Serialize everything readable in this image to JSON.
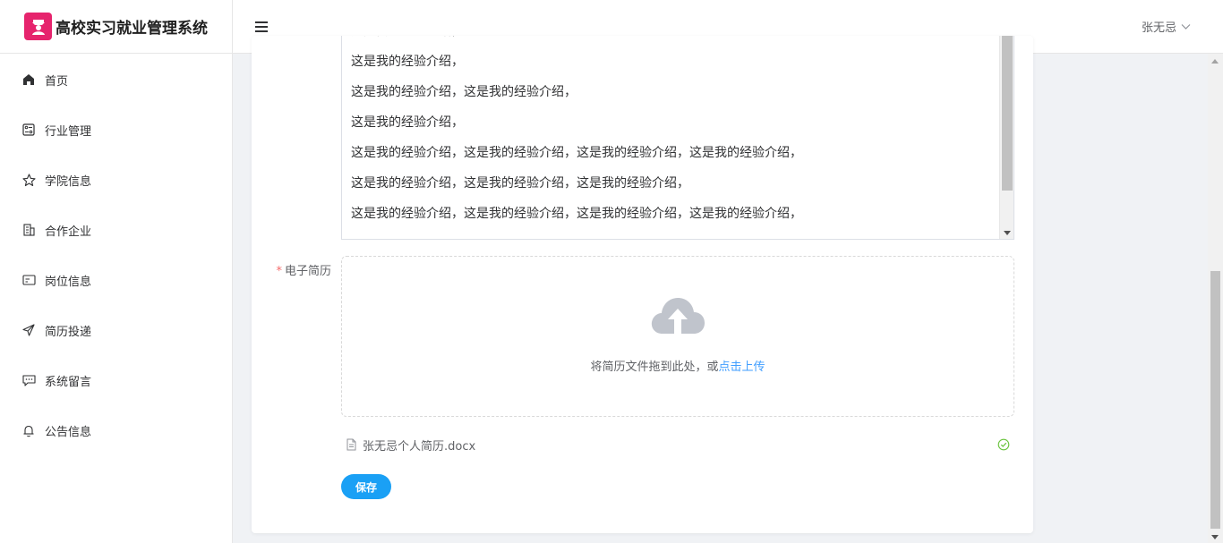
{
  "app": {
    "title": "高校实习就业管理系统"
  },
  "header": {
    "user_name": "张无忌"
  },
  "sidebar": {
    "items": [
      {
        "label": "首页",
        "icon": "home-icon"
      },
      {
        "label": "行业管理",
        "icon": "industry-icon"
      },
      {
        "label": "学院信息",
        "icon": "star-icon"
      },
      {
        "label": "合作企业",
        "icon": "building-icon"
      },
      {
        "label": "岗位信息",
        "icon": "post-icon"
      },
      {
        "label": "简历投递",
        "icon": "send-icon"
      },
      {
        "label": "系统留言",
        "icon": "message-icon"
      },
      {
        "label": "公告信息",
        "icon": "bell-icon"
      }
    ]
  },
  "form": {
    "experience_lines": [
      "这是我的经验介绍，",
      "这是我的经验介绍，",
      "这是我的经验介绍，这是我的经验介绍，",
      "这是我的经验介绍，",
      "这是我的经验介绍，这是我的经验介绍，这是我的经验介绍，这是我的经验介绍，",
      "这是我的经验介绍，这是我的经验介绍，这是我的经验介绍，",
      "这是我的经验介绍，这是我的经验介绍，这是我的经验介绍，这是我的经验介绍，"
    ],
    "resume_label": "电子简历",
    "required_mark": "*",
    "upload_text": "将简历文件拖到此处，或",
    "upload_link": "点击上传",
    "file_name": "张无忌个人简历.docx",
    "save_label": "保存"
  },
  "colors": {
    "accent": "#1aa0f5",
    "link": "#409eff",
    "logo": "#e6246d",
    "success": "#67c23a",
    "required": "#f56c6c"
  }
}
